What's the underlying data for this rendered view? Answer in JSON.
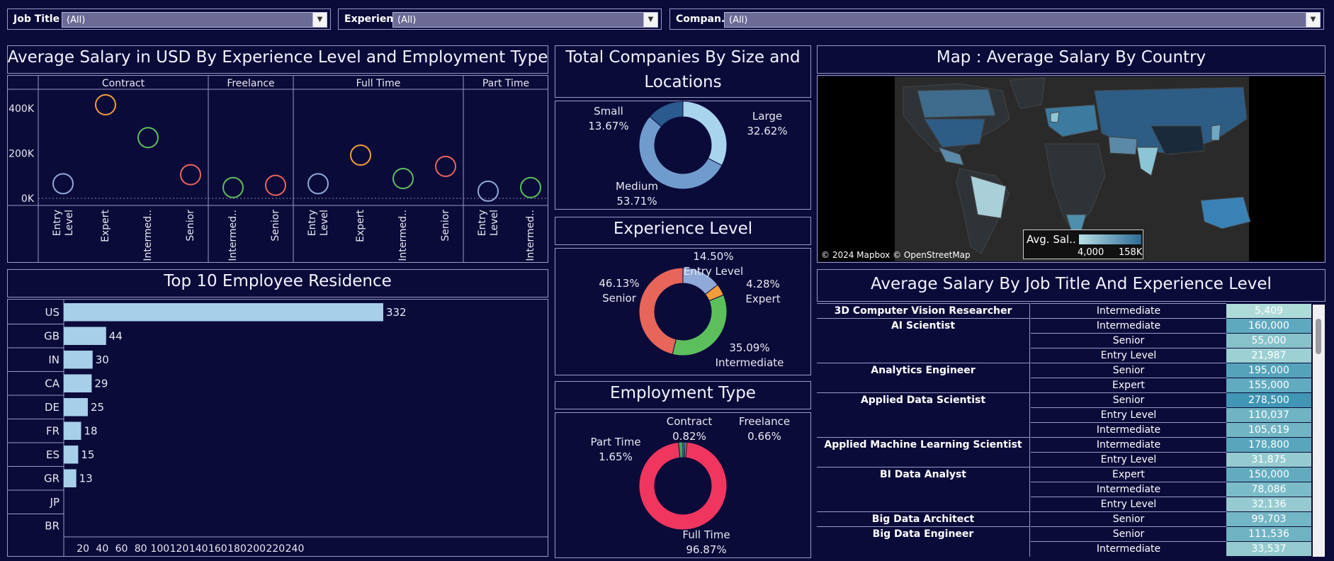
{
  "filters": [
    {
      "label": "Job Title",
      "value": "(All)"
    },
    {
      "label": "Experien..",
      "value": "(All)"
    },
    {
      "label": "Compan..",
      "value": "(All)"
    }
  ],
  "titles": {
    "scatter": "Average Salary in USD By Experience Level and Employment Type",
    "companies_line1": "Total Companies By Size and",
    "companies_line2": "Locations",
    "map": "Map : Average Salary By Country",
    "residence": "Top 10 Employee Residence",
    "experience": "Experience Level",
    "employment": "Employment Type",
    "table": "Average Salary By Job Title And Experience Level"
  },
  "map": {
    "attribution": "© 2024 Mapbox © OpenStreetMap",
    "legend_title": "Avg. Sal..",
    "legend_min": "4,000",
    "legend_max": "158K"
  },
  "colors": {
    "background": "#0b0b3a",
    "bar": "#a7cfea",
    "entry": "#8fa9d8",
    "expert": "#f39c3b",
    "intermediate": "#5cbf5c",
    "senior": "#e8655a",
    "fulltime": "#f0365e"
  },
  "chart_data": [
    {
      "type": "scatter",
      "title": "Average Salary in USD By Experience Level and Employment Type",
      "y_ticks": [
        "400K",
        "200K",
        "0K"
      ],
      "ylim": [
        0,
        450000
      ],
      "panels": [
        {
          "name": "Contract",
          "points": [
            {
              "label": "Entry Level",
              "level": "entry",
              "value": 65000
            },
            {
              "label": "Expert",
              "level": "expert",
              "value": 416000
            },
            {
              "label": "Intermed..",
              "level": "intermediate",
              "value": 270000
            },
            {
              "label": "Senior",
              "level": "senior",
              "value": 105000
            }
          ]
        },
        {
          "name": "Freelance",
          "points": [
            {
              "label": "Intermed..",
              "level": "intermediate",
              "value": 48000
            },
            {
              "label": "Senior",
              "level": "senior",
              "value": 58000
            }
          ]
        },
        {
          "name": "Full Time",
          "points": [
            {
              "label": "Entry Level",
              "level": "entry",
              "value": 65000
            },
            {
              "label": "Expert",
              "level": "expert",
              "value": 192000
            },
            {
              "label": "Intermed..",
              "level": "intermediate",
              "value": 88000
            },
            {
              "label": "Senior",
              "level": "senior",
              "value": 142000
            }
          ]
        },
        {
          "name": "Part Time",
          "points": [
            {
              "label": "Entry Level",
              "level": "entry",
              "value": 32000
            },
            {
              "label": "Intermed..",
              "level": "intermediate",
              "value": 48000
            }
          ]
        }
      ]
    },
    {
      "type": "pie",
      "title": "Total Companies By Size and Locations",
      "slices": [
        {
          "name": "Large",
          "pct": "32.62%",
          "value": 32.62,
          "color": "#a9d4ee"
        },
        {
          "name": "Medium",
          "pct": "53.71%",
          "value": 53.71,
          "color": "#6f9ccc"
        },
        {
          "name": "Small",
          "pct": "13.67%",
          "value": 13.67,
          "color": "#2b5a8e"
        }
      ]
    },
    {
      "type": "pie",
      "title": "Experience Level",
      "slices": [
        {
          "name": "Entry Level",
          "pct": "14.50%",
          "value": 14.5,
          "color": "#8fa9d8"
        },
        {
          "name": "Expert",
          "pct": "4.28%",
          "value": 4.28,
          "color": "#f39c3b"
        },
        {
          "name": "Intermediate",
          "pct": "35.09%",
          "value": 35.09,
          "color": "#5cbf5c"
        },
        {
          "name": "Senior",
          "pct": "46.13%",
          "value": 46.13,
          "color": "#e8655a"
        }
      ]
    },
    {
      "type": "pie",
      "title": "Employment Type",
      "slices": [
        {
          "name": "Contract",
          "pct": "0.82%",
          "value": 0.82,
          "color": "#3a7bc8"
        },
        {
          "name": "Freelance",
          "pct": "0.66%",
          "value": 0.66,
          "color": "#e8a73a"
        },
        {
          "name": "Full Time",
          "pct": "96.87%",
          "value": 96.87,
          "color": "#f0365e"
        },
        {
          "name": "Part Time",
          "pct": "1.65%",
          "value": 1.65,
          "color": "#3aa66a"
        }
      ]
    },
    {
      "type": "bar",
      "title": "Top 10 Employee Residence",
      "categories": [
        "US",
        "GB",
        "IN",
        "CA",
        "DE",
        "FR",
        "ES",
        "GR",
        "JP",
        "BR"
      ],
      "values": [
        332,
        44,
        30,
        29,
        25,
        18,
        15,
        13,
        null,
        null
      ],
      "value_labels": [
        "332",
        "44",
        "30",
        "29",
        "25",
        "18",
        "15",
        "13",
        "",
        ""
      ],
      "x_ticks": [
        "20",
        "40",
        "60",
        "80",
        "100",
        "120",
        "140",
        "160",
        "180",
        "200",
        "220",
        "240"
      ],
      "xlim": [
        0,
        250
      ]
    },
    {
      "type": "table",
      "title": "Average Salary By Job Title And Experience Level",
      "rows": [
        {
          "job": "3D Computer Vision Researcher",
          "level": "Intermediate",
          "salary": "5,409",
          "value": 5409
        },
        {
          "job": "AI Scientist",
          "level": "Intermediate",
          "salary": "160,000",
          "value": 160000
        },
        {
          "job": "",
          "level": "Senior",
          "salary": "55,000",
          "value": 55000
        },
        {
          "job": "",
          "level": "Entry Level",
          "salary": "21,987",
          "value": 21987
        },
        {
          "job": "Analytics Engineer",
          "level": "Senior",
          "salary": "195,000",
          "value": 195000
        },
        {
          "job": "",
          "level": "Expert",
          "salary": "155,000",
          "value": 155000
        },
        {
          "job": "Applied Data Scientist",
          "level": "Senior",
          "salary": "278,500",
          "value": 278500
        },
        {
          "job": "",
          "level": "Entry Level",
          "salary": "110,037",
          "value": 110037
        },
        {
          "job": "",
          "level": "Intermediate",
          "salary": "105,619",
          "value": 105619
        },
        {
          "job": "Applied Machine Learning Scientist",
          "level": "Intermediate",
          "salary": "178,800",
          "value": 178800
        },
        {
          "job": "",
          "level": "Entry Level",
          "salary": "31,875",
          "value": 31875
        },
        {
          "job": "BI Data Analyst",
          "level": "Expert",
          "salary": "150,000",
          "value": 150000
        },
        {
          "job": "",
          "level": "Intermediate",
          "salary": "78,086",
          "value": 78086
        },
        {
          "job": "",
          "level": "Entry Level",
          "salary": "32,136",
          "value": 32136
        },
        {
          "job": "Big Data Architect",
          "level": "Senior",
          "salary": "99,703",
          "value": 99703
        },
        {
          "job": "Big Data Engineer",
          "level": "Senior",
          "salary": "111,536",
          "value": 111536
        },
        {
          "job": "",
          "level": "Intermediate",
          "salary": "33,537",
          "value": 33537
        }
      ]
    }
  ]
}
